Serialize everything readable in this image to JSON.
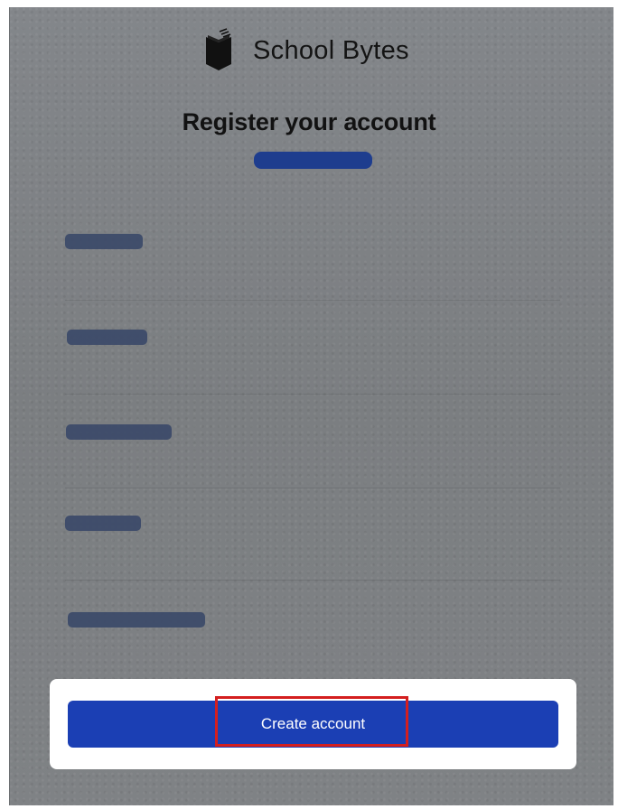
{
  "brand": {
    "name": "School Bytes",
    "logo_icon": "book-icon"
  },
  "page": {
    "title": "Register your account"
  },
  "actions": {
    "create_account_label": "Create account"
  },
  "colors": {
    "primary": "#1b3fb4",
    "highlight": "#d41f1f",
    "background": "#7e8183"
  }
}
